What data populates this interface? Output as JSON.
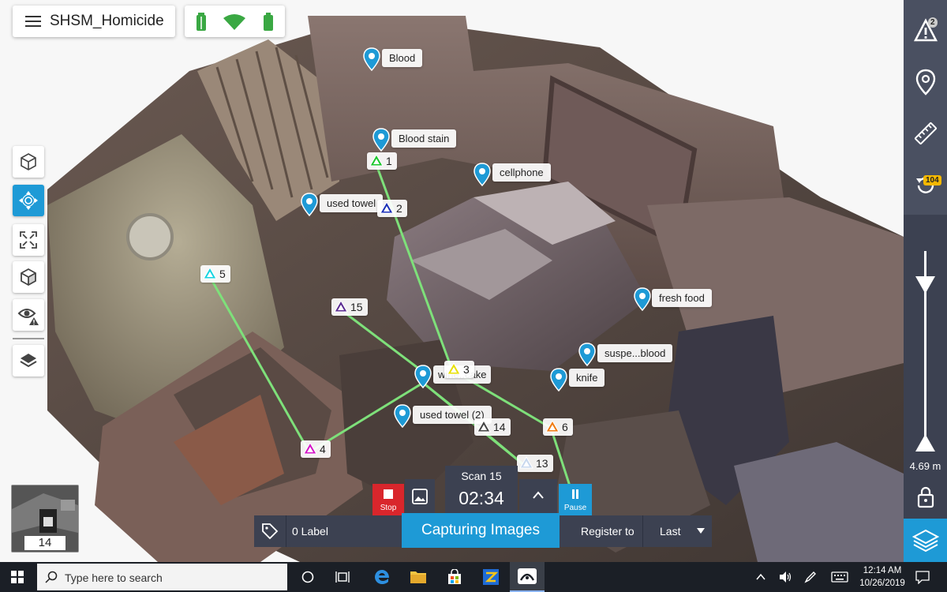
{
  "app": {
    "project_title": "SHSM_Homicide",
    "status_icons": [
      "device-battery-icon",
      "wifi-icon",
      "battery-icon"
    ]
  },
  "left_toolbar": {
    "tools": [
      {
        "name": "3d-view-icon",
        "active": false
      },
      {
        "name": "orbit-move-icon",
        "active": true
      },
      {
        "name": "fit-view-icon",
        "active": false
      },
      {
        "name": "box-view-icon",
        "active": false
      },
      {
        "name": "visibility-warning-icon",
        "active": false
      },
      {
        "name": "layers-icon",
        "active": false
      }
    ]
  },
  "markers": [
    {
      "label": "Blood"
    },
    {
      "label": "Blood stain"
    },
    {
      "label": "cellphone"
    },
    {
      "label": "used towel"
    },
    {
      "label": "fresh food"
    },
    {
      "label": "suspe...blood"
    },
    {
      "label": "knife"
    },
    {
      "label": "used towel (2)"
    },
    {
      "label": "wine..cake"
    }
  ],
  "scan_points": [
    {
      "number": "1",
      "color": "#19c72a"
    },
    {
      "number": "2",
      "color": "#1a2fb8"
    },
    {
      "number": "3",
      "color": "#e8e000"
    },
    {
      "number": "4",
      "color": "#d313c7"
    },
    {
      "number": "5",
      "color": "#16d3e0"
    },
    {
      "number": "6",
      "color": "#f07a10"
    },
    {
      "number": "13",
      "color": "#c8d8ee"
    },
    {
      "number": "14",
      "color": "#444444"
    },
    {
      "number": "15",
      "color": "#5a2a90"
    }
  ],
  "right_rail": {
    "warning_badge": "2",
    "history_badge": "104",
    "range_value": "4.69 m"
  },
  "minimap": {
    "count": "14"
  },
  "capture": {
    "stop_label": "Stop",
    "pause_label": "Pause",
    "scan_label": "Scan 15",
    "timer": "02:34",
    "label_count": "0 Label",
    "status": "Capturing Images",
    "register_label": "Register to",
    "register_value": "Last"
  },
  "taskbar": {
    "search_placeholder": "Type here to search",
    "time": "12:14 AM",
    "date": "10/26/2019"
  },
  "colors": {
    "accent": "#1e9ad6",
    "rail": "#3c4151",
    "stop": "#d9262c",
    "path_line": "#7ee07a"
  }
}
